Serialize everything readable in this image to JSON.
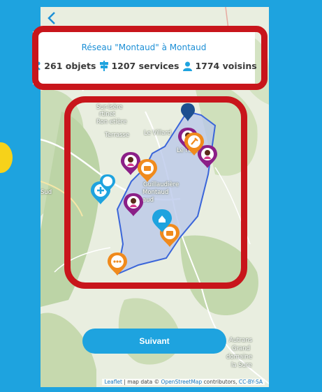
{
  "header": {
    "network_title": "Réseau \"Montaud\" à Montaud",
    "objects": "261 objets",
    "services": "1207 services",
    "neighbours": "1774 voisins"
  },
  "map": {
    "places": {
      "isere": "Sur-Isère",
      "martinet": "rtinet",
      "rovetiere": "Ron  etière",
      "terrasse": "Terrasse",
      "villard": "Le Villard",
      "fayet": "Le Fayet",
      "guillaudiere": "Guillaudière",
      "montaud": "Montaud",
      "aud": "aud",
      "sud": "Sud",
      "autrans": "Autrans",
      "grand": "Grand",
      "domaine": "domaine",
      "sure": "la Sure"
    },
    "attribution": {
      "leaflet": "Leaflet",
      "map_data": " | map data © ",
      "osm": "OpenStreetMap",
      "contributors": " contributors, ",
      "license": "CC-BY-SA"
    }
  },
  "actions": {
    "next_label": "Suivant"
  },
  "colors": {
    "accent": "#1ea3df",
    "highlight": "#c8151b",
    "marker_purple": "#8b1f87",
    "marker_orange": "#f08a1c",
    "marker_blue": "#1ea3df",
    "marker_navy": "#1d4f8f",
    "zone_fill": "#b7c5ea",
    "zone_stroke": "#3a65d9"
  },
  "icons": [
    "back-arrow-icon",
    "tools-icon",
    "signpost-icon",
    "person-icon",
    "person-marker-icon",
    "tool-marker-icon",
    "medical-marker-icon",
    "home-marker-icon",
    "more-marker-icon",
    "location-marker-icon"
  ]
}
